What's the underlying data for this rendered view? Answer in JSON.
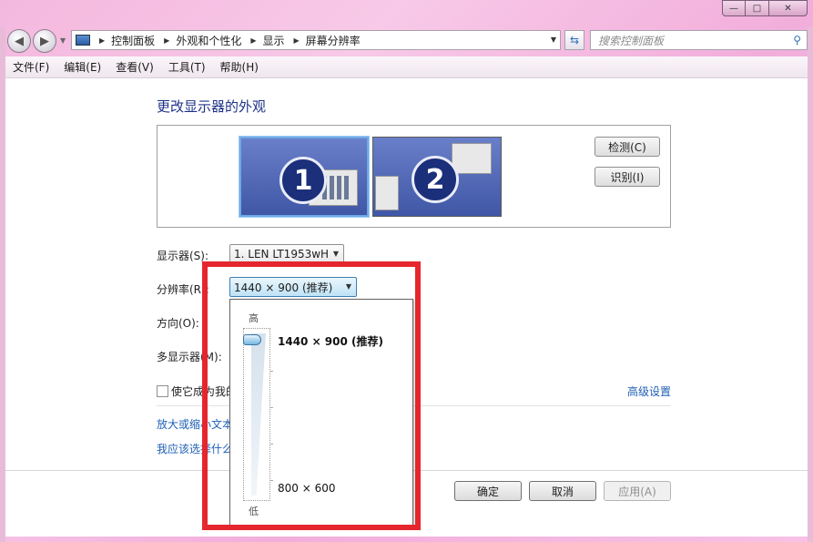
{
  "window": {
    "caption_buttons": {
      "minimize": "—",
      "maximize": "□",
      "close": "✕"
    }
  },
  "addressbar": {
    "breadcrumbs": [
      "控制面板",
      "外观和个性化",
      "显示",
      "屏幕分辨率"
    ],
    "search_placeholder": "搜索控制面板"
  },
  "menu": {
    "items": [
      "文件(F)",
      "编辑(E)",
      "查看(V)",
      "工具(T)",
      "帮助(H)"
    ]
  },
  "main": {
    "title": "更改显示器的外观",
    "monitors": [
      {
        "number": "1"
      },
      {
        "number": "2"
      }
    ],
    "detect_button": "检测(C)",
    "identify_button": "识别(I)",
    "display_label": "显示器(S):",
    "display_value": "1. LEN LT1953wH",
    "resolution_label": "分辨率(R):",
    "resolution_value": "1440 × 900 (推荐)",
    "orientation_label": "方向(O):",
    "multi_display_label": "多显示器(M):",
    "checkbox_label": "使它成为我的",
    "advanced_link": "高级设置",
    "enlarge_link": "放大或缩小文本",
    "which_link": "我应该选择什么",
    "ok_button": "确定",
    "cancel_button": "取消",
    "apply_button": "应用(A)"
  },
  "resolution_panel": {
    "high_label": "高",
    "low_label": "低",
    "max_resolution": "1440 × 900 (推荐)",
    "min_resolution": "800 × 600",
    "slider_level": 1.0
  },
  "colors": {
    "highlight": "#e5262e",
    "link": "#1f5fb5",
    "title": "#1e3287"
  }
}
